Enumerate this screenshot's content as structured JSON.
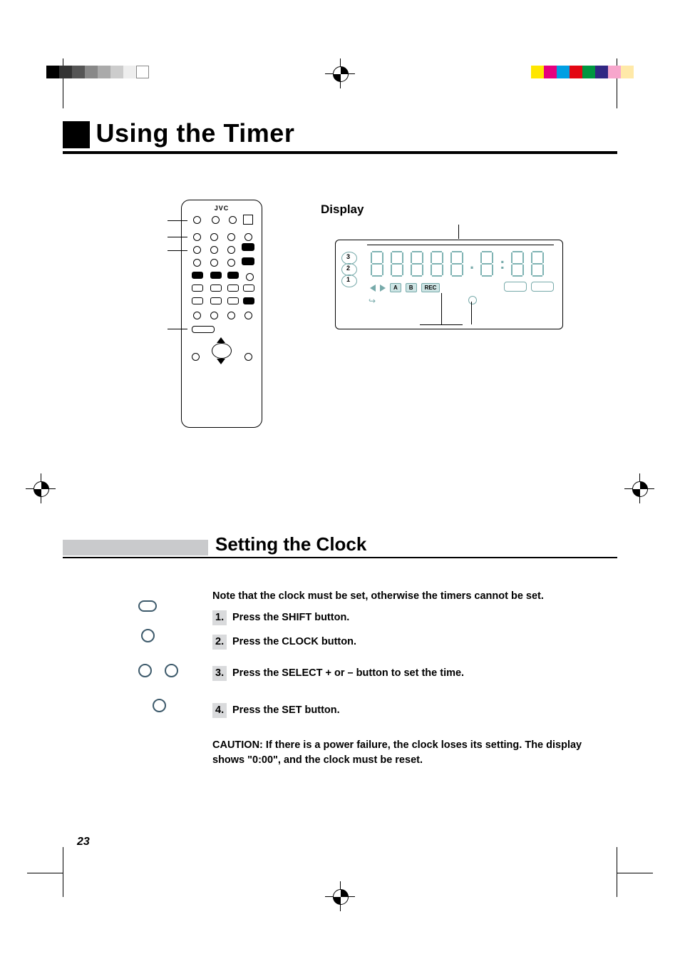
{
  "main_title": "Using the Timer",
  "display_label": "Display",
  "remote": {
    "brand": "JVC"
  },
  "display_panel": {
    "disc_numbers": [
      "3",
      "2",
      "1"
    ],
    "seg_dot_a": ".",
    "seg_colon": ":",
    "indicator_A": "A",
    "indicator_B": "B",
    "indicator_REC": "REC"
  },
  "section_title": "Setting the Clock",
  "note_line": "Note that the clock must be set, otherwise the timers cannot be set.",
  "steps": {
    "s1_num": "1.",
    "s1_text": "Press the SHIFT button.",
    "s2_num": "2.",
    "s2_text": "Press the CLOCK button.",
    "s3_num": "3.",
    "s3_text": "Press the SELECT + or – button to set the time.",
    "s4_num": "4.",
    "s4_text": "Press the SET button."
  },
  "caution_label": "CAUTION:",
  "caution_text": " If there is a power failure, the clock loses its setting. The display shows \"0:00\", and the clock must be reset.",
  "page_number": "23"
}
